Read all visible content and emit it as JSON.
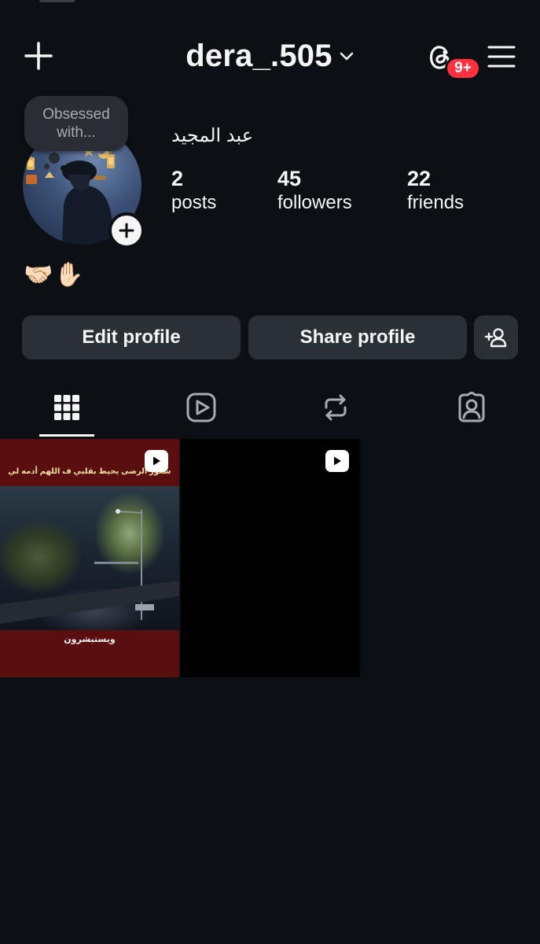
{
  "header": {
    "username": "dera_.505",
    "notification_badge": "9+"
  },
  "note": {
    "line1": "Obsessed",
    "line2": "with..."
  },
  "profile": {
    "display_name": "عبد المجيد",
    "bio": "🤝🏻✋🏻",
    "stats": [
      {
        "value": "2",
        "label": "posts"
      },
      {
        "value": "45",
        "label": "followers"
      },
      {
        "value": "22",
        "label": "friends"
      }
    ]
  },
  "buttons": {
    "edit": "Edit profile",
    "share": "Share profile"
  },
  "tabs": [
    {
      "icon": "grid-icon",
      "active": true
    },
    {
      "icon": "reels-icon",
      "active": false
    },
    {
      "icon": "reposts-icon",
      "active": false
    },
    {
      "icon": "tagged-icon",
      "active": false
    }
  ],
  "posts": [
    {
      "type": "reel",
      "caption_top": "شعور الرضى يحيط بقلبي ف اللهم أدمه لي",
      "caption_bottom": "ويستبشرون"
    },
    {
      "type": "reel"
    }
  ],
  "colors": {
    "background": "#0c1014",
    "button": "#2b3036",
    "badge": "#ff3040"
  }
}
